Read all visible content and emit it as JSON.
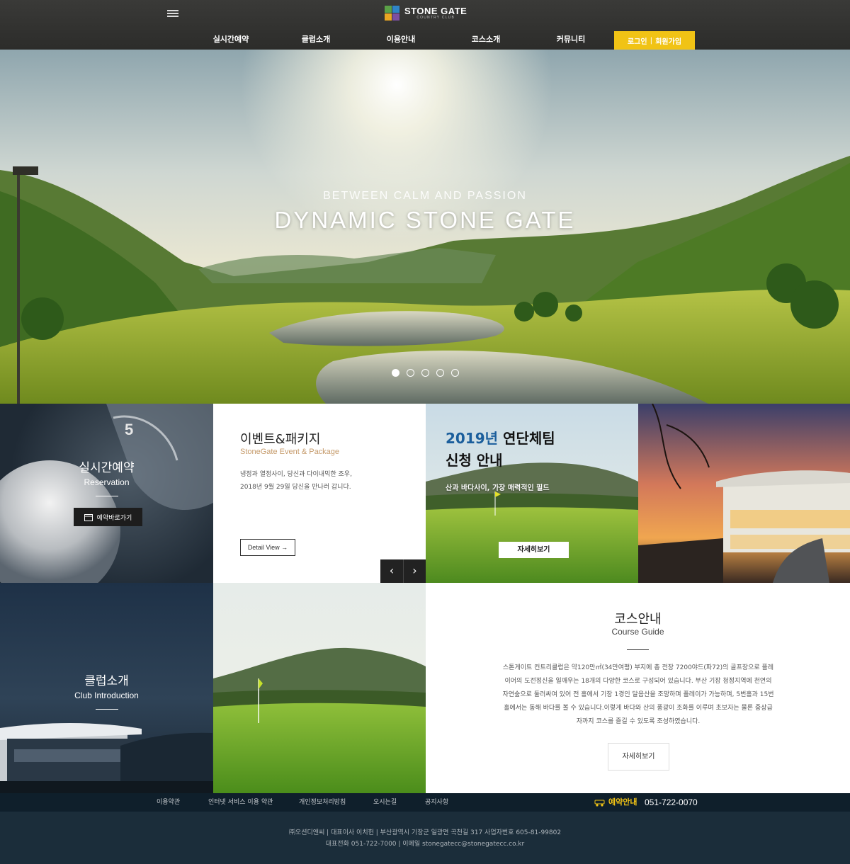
{
  "header": {
    "logo": {
      "title": "STONE GATE",
      "subtitle": "COUNTRY CLUB"
    },
    "nav": [
      "실시간예약",
      "클럽소개",
      "이용안내",
      "코스소개",
      "커뮤니티"
    ],
    "login": "로그인",
    "signup": "회원가입",
    "accent": "#f1c315"
  },
  "hero": {
    "subtitle": "BETWEEN CALM AND PASSION",
    "title": "DYNAMIC STONE GATE",
    "slide_count": 5,
    "active_slide": 1
  },
  "tiles": {
    "reservation": {
      "title": "실시간예약",
      "subtitle": "Reservation",
      "button": "예약바로가기"
    },
    "event": {
      "title": "이벤트&패키지",
      "subtitle": "StoneGate Event & Package",
      "desc_line1": "냉정과 열정사이, 당신과 다이내믹한 조우,",
      "desc_line2": "2018년 9월 29일 당신을 만나러 갑니다.",
      "button": "Detail View →",
      "prev": "‹",
      "next": "›"
    },
    "team": {
      "title_highlight": "2019년",
      "title_rest": "연단체팀",
      "title_line2": "신청 안내",
      "subtitle": "산과 바다사이, 가장 매력적인 필드",
      "button": "자세히보기"
    },
    "club": {
      "title": "클럽소개",
      "subtitle": "Club Introduction"
    },
    "course": {
      "title": "코스안내",
      "subtitle": "Course Guide",
      "description": "스톤게이트 컨트리클럽은 약120만㎡(34만여평) 부지에 총 전장 7200야드(파72)의 골프장으로 플레이어의 도전정신을 일깨우는 18개의 다양한 코스로 구성되어 있습니다. 부산 기장 청정지역에 천연의 자연숲으로 둘러싸여 있어 전 홀에서 기장 1경인 달음산을 조망하며 플레이가 가능하며, 5번홀과 15번홀에서는 동해 바다를 볼 수 있습니다.이렇게 바다와 산의 풍광이 조화를 이루며 초보자는 물론 중상급자까지 코스를 즐길 수 있도록 조성하였습니다.",
      "button": "자세히보기"
    }
  },
  "footer": {
    "links": [
      "이용약관",
      "인터넷 서비스 이용 약관",
      "개인정보처리방침",
      "오시는길",
      "공지사항"
    ],
    "reservation_label": "예약안내",
    "reservation_phone": "051-722-0070",
    "info_line1": "㈜오션디앤씨 | 대표이사 이치헌 | 부산광역시 기장군 일광면 곡천길 317 사업자번호 605-81-99802",
    "info_line2": "대표전화 051-722-7000 | 이메일 stonegatecc@stonegatecc.co.kr"
  }
}
